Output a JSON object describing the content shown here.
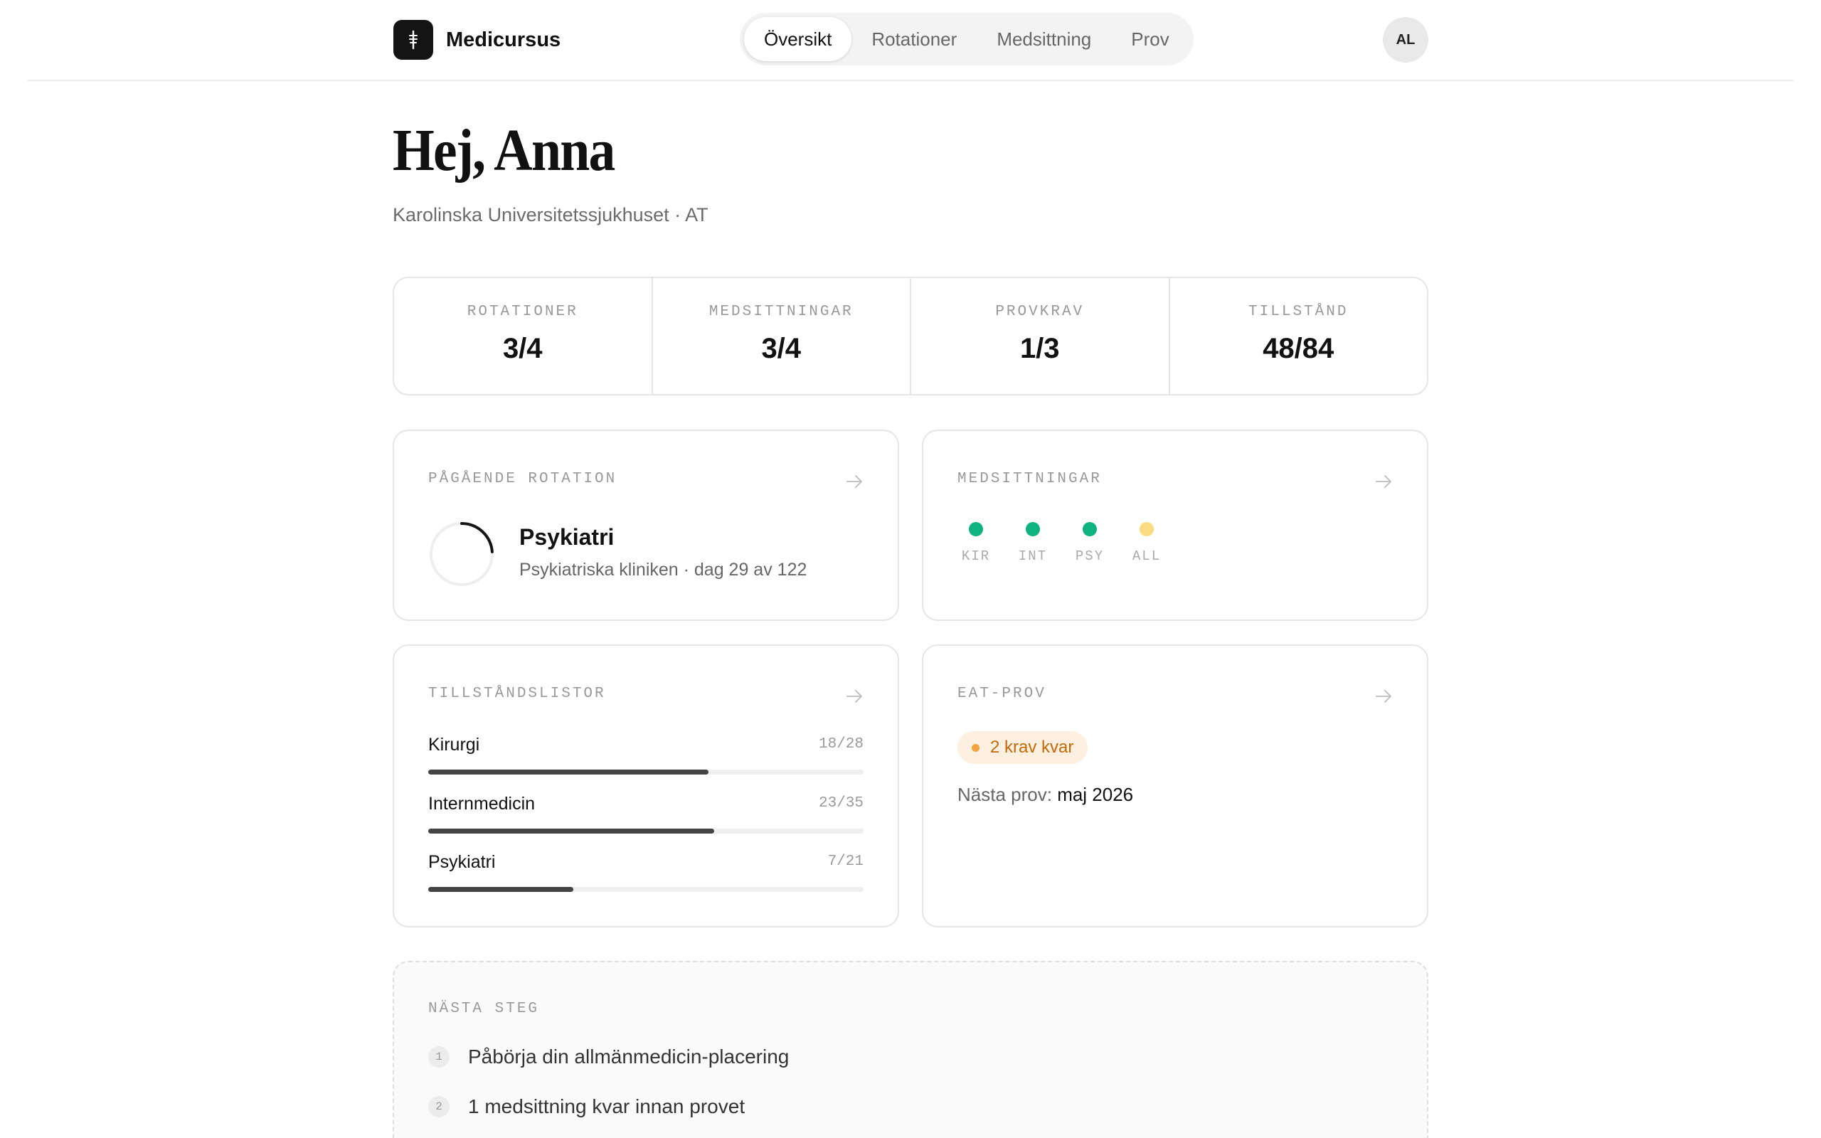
{
  "app": {
    "name": "Medicursus",
    "logo_icon": "asclepius-staff-icon"
  },
  "nav": {
    "tabs": [
      {
        "label": "Översikt",
        "active": true
      },
      {
        "label": "Rotationer",
        "active": false
      },
      {
        "label": "Medsittning",
        "active": false
      },
      {
        "label": "Prov",
        "active": false
      }
    ]
  },
  "user": {
    "initials": "AL"
  },
  "greeting": {
    "title": "Hej, Anna",
    "subtitle": "Karolinska Universitetssjukhuset · AT"
  },
  "stats": [
    {
      "label": "ROTATIONER",
      "value": "3/4"
    },
    {
      "label": "MEDSITTNINGAR",
      "value": "3/4"
    },
    {
      "label": "PROVKRAV",
      "value": "1/3"
    },
    {
      "label": "TILLSTÅND",
      "value": "48/84"
    }
  ],
  "current_rotation": {
    "label": "PÅGÅENDE ROTATION",
    "name": "Psykiatri",
    "detail": "Psykiatriska kliniken · dag 29 av 122",
    "day": 29,
    "total_days": 122
  },
  "medsittningar": {
    "label": "MEDSITTNINGAR",
    "items": [
      {
        "code": "KIR",
        "done": true,
        "color": "#0fb37d"
      },
      {
        "code": "INT",
        "done": true,
        "color": "#0fb37d"
      },
      {
        "code": "PSY",
        "done": true,
        "color": "#0fb37d"
      },
      {
        "code": "ALL",
        "done": false,
        "color": "#fbdc82"
      }
    ]
  },
  "tillstand": {
    "label": "TILLSTÅNDSLISTOR",
    "items": [
      {
        "name": "Kirurgi",
        "count": "18/28",
        "fraction": 0.643
      },
      {
        "name": "Internmedicin",
        "count": "23/35",
        "fraction": 0.657
      },
      {
        "name": "Psykiatri",
        "count": "7/21",
        "fraction": 0.333
      }
    ]
  },
  "eat_prov": {
    "label": "EAT-PROV",
    "badge": "2 krav kvar",
    "next_label": "Nästa prov:",
    "next_value": "maj 2026"
  },
  "next_steps": {
    "label": "NÄSTA STEG",
    "items": [
      {
        "num": "1",
        "text": "Påbörja din allmänmedicin-placering"
      },
      {
        "num": "2",
        "text": "1 medsittning kvar innan provet"
      }
    ]
  },
  "colors": {
    "accent_dark": "#141414",
    "done_green": "#0fb37d",
    "pending_yellow": "#fbdc82",
    "warning_orange": "#c26a0a"
  }
}
